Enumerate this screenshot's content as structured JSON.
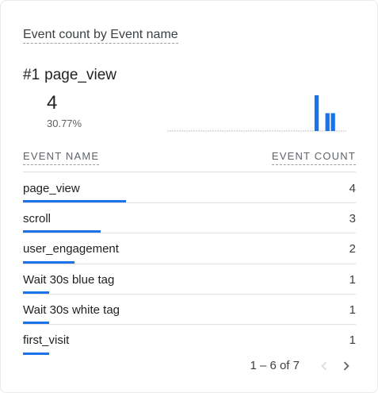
{
  "card": {
    "title": "Event count by Event name",
    "top_item": {
      "rank": "#1",
      "name": "page_view",
      "value": "4",
      "percent": "30.77%"
    },
    "sparkline_values": [
      0,
      0,
      0,
      0,
      0,
      0,
      0,
      0,
      0,
      0,
      0,
      0,
      0,
      0,
      0,
      0,
      0,
      0,
      0,
      0,
      0,
      0,
      0,
      0,
      0,
      0,
      0,
      4,
      0,
      2,
      2,
      0,
      0
    ],
    "columns": {
      "name": "EVENT NAME",
      "count": "EVENT COUNT"
    },
    "rows": [
      {
        "name": "page_view",
        "value": "4",
        "count": 4
      },
      {
        "name": "scroll",
        "value": "3",
        "count": 3
      },
      {
        "name": "user_engagement",
        "value": "2",
        "count": 2
      },
      {
        "name": "Wait 30s blue tag",
        "value": "1",
        "count": 1
      },
      {
        "name": "Wait 30s white tag",
        "value": "1",
        "count": 1
      },
      {
        "name": "first_visit",
        "value": "1",
        "count": 1
      }
    ],
    "max_count": 4,
    "pagination": {
      "range": "1 – 6 of 7"
    },
    "colors": {
      "accent": "#1a73e8",
      "disabled": "#dadce0",
      "icon": "#5f6368"
    }
  }
}
